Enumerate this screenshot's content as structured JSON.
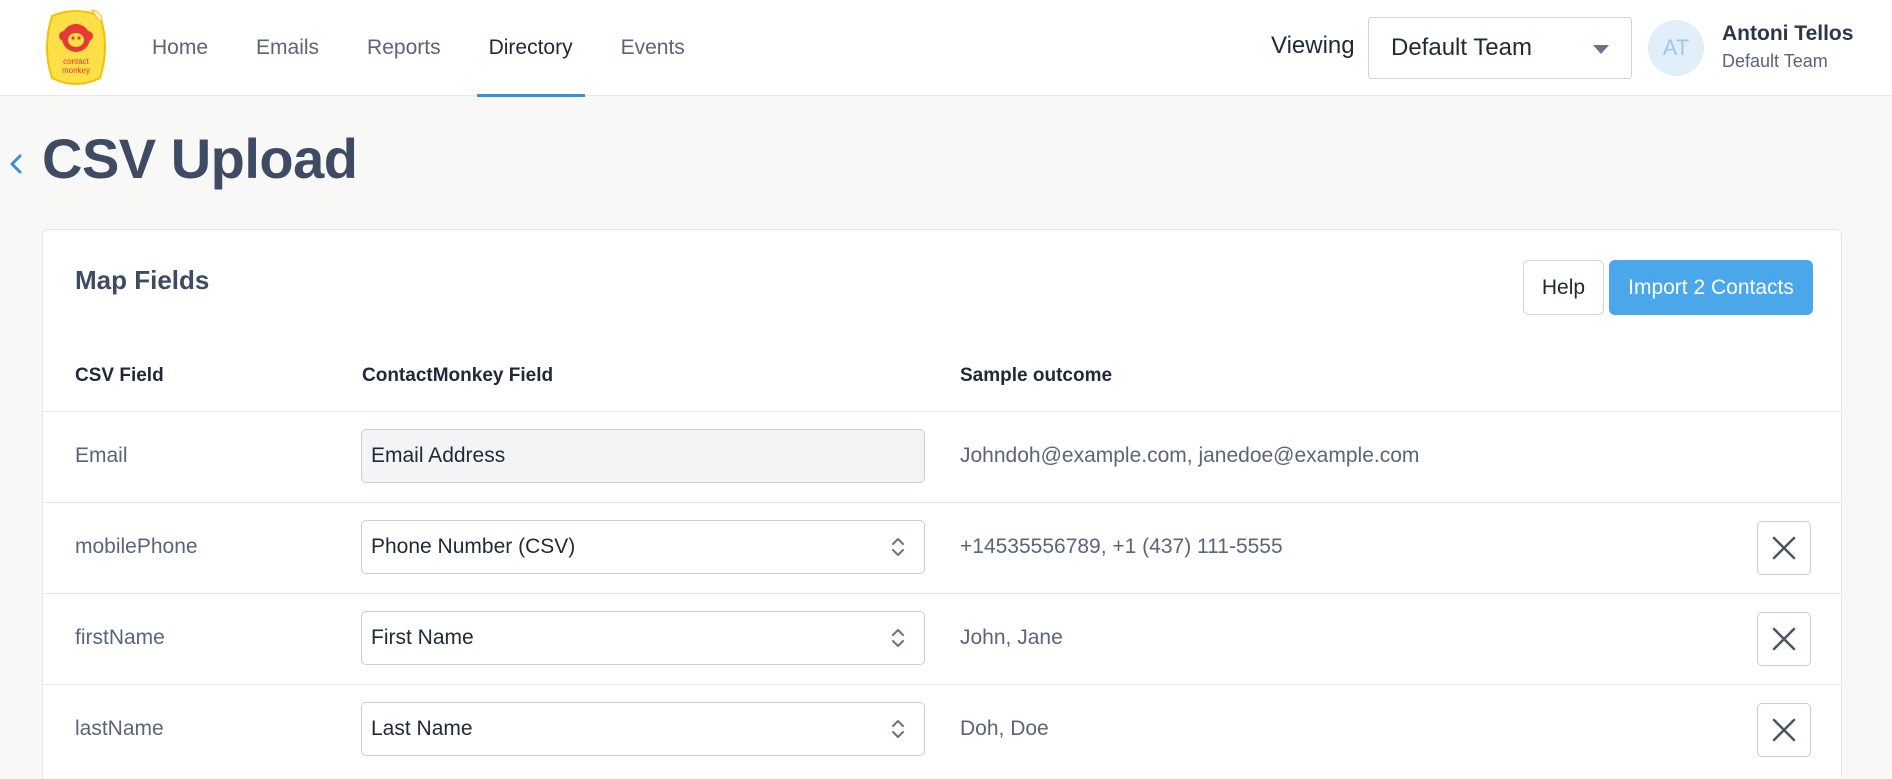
{
  "nav": {
    "logo_text": [
      "contact",
      "monkey"
    ],
    "items": [
      {
        "label": "Home",
        "active": false
      },
      {
        "label": "Emails",
        "active": false
      },
      {
        "label": "Reports",
        "active": false
      },
      {
        "label": "Directory",
        "active": true
      },
      {
        "label": "Events",
        "active": false
      }
    ],
    "viewing_label": "Viewing",
    "team_select_value": "Default Team",
    "user": {
      "initials": "AT",
      "name": "Antoni Tellos",
      "team": "Default Team"
    }
  },
  "page": {
    "title": "CSV Upload"
  },
  "card": {
    "title": "Map Fields",
    "help_label": "Help",
    "import_label": "Import 2 Contacts",
    "columns": [
      "CSV Field",
      "ContactMonkey Field",
      "Sample outcome"
    ],
    "rows": [
      {
        "csv_field": "Email",
        "cm_field": "Email Address",
        "sample": "Johndoh@example.com, janedoe@example.com"
      },
      {
        "csv_field": "mobilePhone",
        "cm_field": "Phone Number (CSV)",
        "sample": "+14535556789, +1 (437) 111-5555"
      },
      {
        "csv_field": "firstName",
        "cm_field": "First Name",
        "sample": "John, Jane"
      },
      {
        "csv_field": "lastName",
        "cm_field": "Last Name",
        "sample": "Doh, Doe"
      }
    ]
  },
  "colors": {
    "accent": "#4aa8ea",
    "nav_underline": "#3b8fd9",
    "logo_yellow": "#fde047",
    "logo_red": "#e53935"
  },
  "icons": {
    "back": "chevron-left-icon",
    "select": "caret-down-icon",
    "updown": "chevron-up-down-icon",
    "remove": "close-icon"
  }
}
